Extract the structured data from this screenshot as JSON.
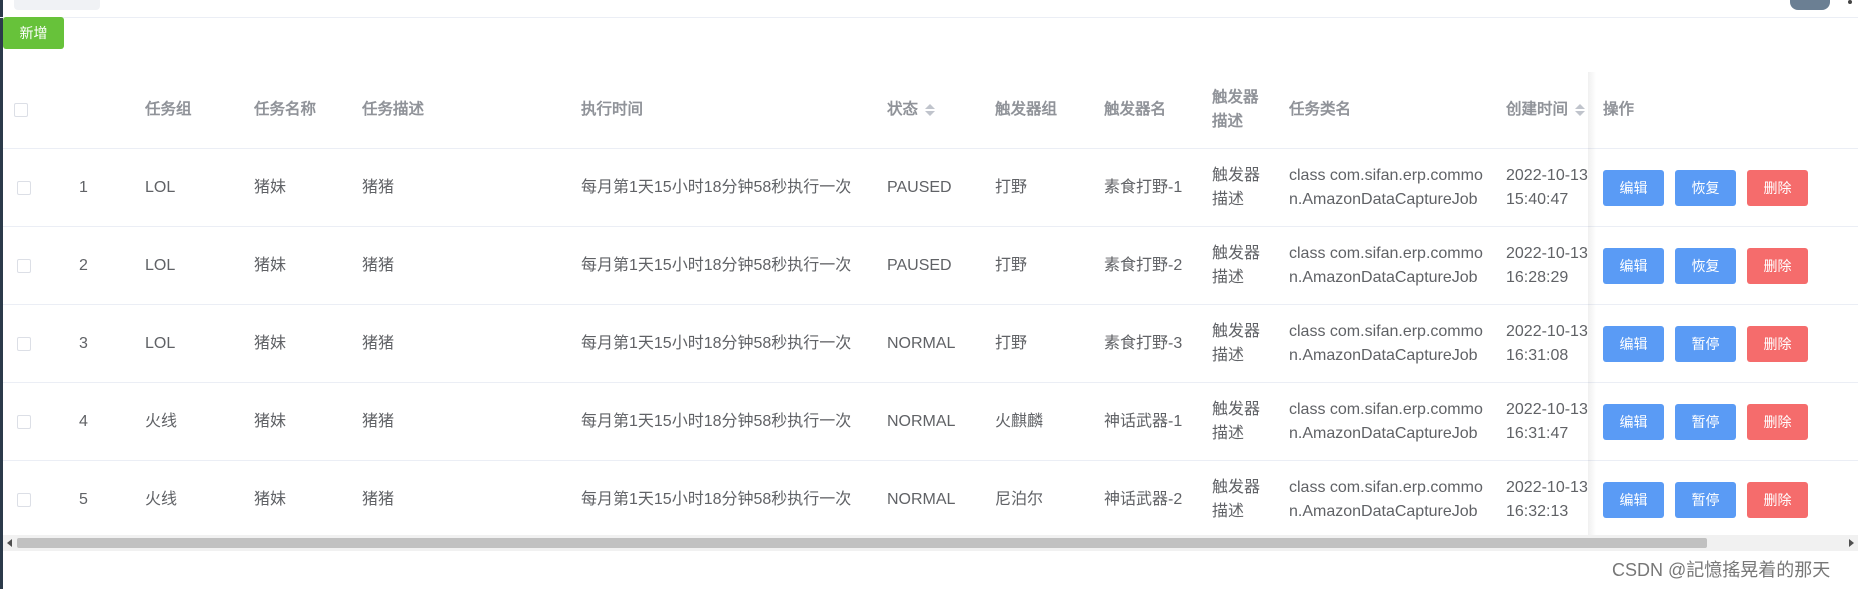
{
  "toolbar": {
    "add_label": "新增"
  },
  "table": {
    "headers": {
      "group": "任务组",
      "name": "任务名称",
      "desc": "任务描述",
      "exec": "执行时间",
      "status": "状态",
      "trig_group": "触发器组",
      "trig_name": "触发器名",
      "trig_desc_1": "触发器",
      "trig_desc_2": "描述",
      "class": "任务类名",
      "created": "创建时间",
      "ops": "操作"
    },
    "rows": [
      {
        "index": "1",
        "group": "LOL",
        "name": "猪妹",
        "desc": "猪猪",
        "exec": "每月第1天15小时18分钟58秒执行一次",
        "status": "PAUSED",
        "trig_group": "打野",
        "trig_name": "素食打野-1",
        "trig_desc_1": "触发器",
        "trig_desc_2": "描述",
        "class_1": "class com.sifan.erp.commo",
        "class_2": "n.AmazonDataCaptureJob",
        "created_1": "2022-10-13",
        "created_2": "15:40:47",
        "edit": "编辑",
        "toggle": "恢复",
        "delete": "删除"
      },
      {
        "index": "2",
        "group": "LOL",
        "name": "猪妹",
        "desc": "猪猪",
        "exec": "每月第1天15小时18分钟58秒执行一次",
        "status": "PAUSED",
        "trig_group": "打野",
        "trig_name": "素食打野-2",
        "trig_desc_1": "触发器",
        "trig_desc_2": "描述",
        "class_1": "class com.sifan.erp.commo",
        "class_2": "n.AmazonDataCaptureJob",
        "created_1": "2022-10-13",
        "created_2": "16:28:29",
        "edit": "编辑",
        "toggle": "恢复",
        "delete": "删除"
      },
      {
        "index": "3",
        "group": "LOL",
        "name": "猪妹",
        "desc": "猪猪",
        "exec": "每月第1天15小时18分钟58秒执行一次",
        "status": "NORMAL",
        "trig_group": "打野",
        "trig_name": "素食打野-3",
        "trig_desc_1": "触发器",
        "trig_desc_2": "描述",
        "class_1": "class com.sifan.erp.commo",
        "class_2": "n.AmazonDataCaptureJob",
        "created_1": "2022-10-13",
        "created_2": "16:31:08",
        "edit": "编辑",
        "toggle": "暂停",
        "delete": "删除"
      },
      {
        "index": "4",
        "group": "火线",
        "name": "猪妹",
        "desc": "猪猪",
        "exec": "每月第1天15小时18分钟58秒执行一次",
        "status": "NORMAL",
        "trig_group": "火麒麟",
        "trig_name": "神话武器-1",
        "trig_desc_1": "触发器",
        "trig_desc_2": "描述",
        "class_1": "class com.sifan.erp.commo",
        "class_2": "n.AmazonDataCaptureJob",
        "created_1": "2022-10-13",
        "created_2": "16:31:47",
        "edit": "编辑",
        "toggle": "暂停",
        "delete": "删除"
      },
      {
        "index": "5",
        "group": "火线",
        "name": "猪妹",
        "desc": "猪猪",
        "exec": "每月第1天15小时18分钟58秒执行一次",
        "status": "NORMAL",
        "trig_group": "尼泊尔",
        "trig_name": "神话武器-2",
        "trig_desc_1": "触发器",
        "trig_desc_2": "描述",
        "class_1": "class com.sifan.erp.commo",
        "class_2": "n.AmazonDataCaptureJob",
        "created_1": "2022-10-13",
        "created_2": "16:32:13",
        "edit": "编辑",
        "toggle": "暂停",
        "delete": "删除"
      }
    ]
  },
  "watermark": "CSDN @記憶搖晃着的那天",
  "colors": {
    "primary": "#5a9bf5",
    "danger": "#f56c6c",
    "success": "#67c23a"
  }
}
